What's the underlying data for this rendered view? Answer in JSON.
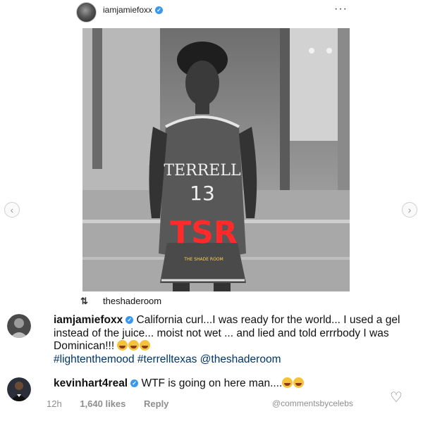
{
  "post": {
    "username": "iamjamiefoxx",
    "more_label": "···"
  },
  "photo": {
    "jersey_text": "TERRELL",
    "jersey_number": "13",
    "watermark_letters": "TSR",
    "watermark_caption": "THE SHADE ROOM"
  },
  "carousel": {
    "prev_label": "‹",
    "next_label": "›"
  },
  "repost": {
    "icon": "retweet-icon",
    "username": "theshaderoom"
  },
  "caption": {
    "username": "iamjamiefoxx",
    "text": "California curl...I was ready for the world... I used a gel instead of the juice... moist not wet ... and lied and told errrbody I was Dominican!!!",
    "hashtags": "#lightenthemood #terrelltexas @theshaderoom"
  },
  "reply": {
    "username": "kevinhart4real",
    "text": "WTF is going on here man....",
    "time": "12h",
    "likes": "1,640 likes",
    "reply_label": "Reply"
  },
  "credit": "@commentsbycelebs",
  "colors": {
    "verified": "#3897f0",
    "tag": "#003569",
    "muted": "#8e8e8e",
    "watermark": "#ff2a2a"
  }
}
